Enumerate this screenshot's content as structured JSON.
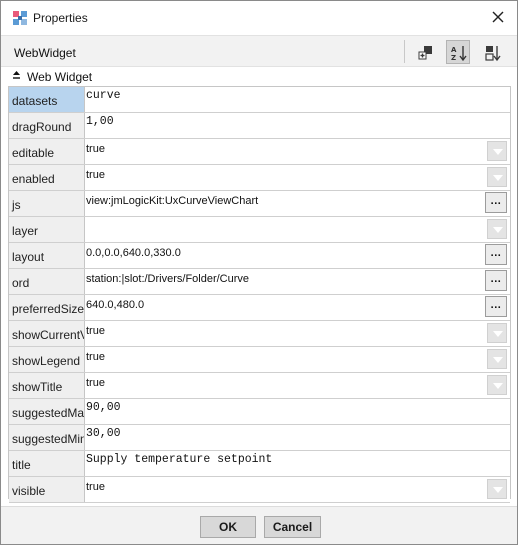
{
  "window": {
    "title": "Properties",
    "icon": "properties-app-icon",
    "close_icon": "close-icon"
  },
  "header": {
    "title": "WebWidget",
    "tools": [
      {
        "icon": "add-slot-icon",
        "active": false
      },
      {
        "icon": "sort-alphabetical-icon",
        "active": true
      },
      {
        "icon": "sort-order-icon",
        "active": false
      }
    ]
  },
  "breadcrumb": {
    "label": "Web Widget",
    "icon": "collapse-up-icon"
  },
  "properties": [
    {
      "name": "datasets",
      "value": "curve",
      "editor": "text",
      "mono": true,
      "selected": true
    },
    {
      "name": "dragRound",
      "value": "1,00",
      "editor": "text",
      "mono": true
    },
    {
      "name": "editable",
      "value": "true",
      "editor": "dropdown"
    },
    {
      "name": "enabled",
      "value": "true",
      "editor": "dropdown"
    },
    {
      "name": "js",
      "value": "view:jmLogicKit:UxCurveViewChart",
      "editor": "ellipsis",
      "button": "..."
    },
    {
      "name": "layer",
      "value": "",
      "editor": "dropdown"
    },
    {
      "name": "layout",
      "value": "0.0,0.0,640.0,330.0",
      "editor": "ellipsis",
      "button": "..."
    },
    {
      "name": "ord",
      "value": "station:|slot:/Drivers/Folder/Curve",
      "editor": "ellipsis",
      "button": "..."
    },
    {
      "name": "preferredSize",
      "value": "640.0,480.0",
      "editor": "ellipsis",
      "button": "..."
    },
    {
      "name": "showCurrentValue",
      "value": "true",
      "editor": "dropdown"
    },
    {
      "name": "showLegend",
      "value": "true",
      "editor": "dropdown"
    },
    {
      "name": "showTitle",
      "value": "true",
      "editor": "dropdown"
    },
    {
      "name": "suggestedMax",
      "value": "90,00",
      "editor": "text",
      "mono": true
    },
    {
      "name": "suggestedMin",
      "value": "30,00",
      "editor": "text",
      "mono": true
    },
    {
      "name": "title",
      "value": "Supply temperature setpoint",
      "editor": "text",
      "mono": true
    },
    {
      "name": "visible",
      "value": "true",
      "editor": "dropdown"
    }
  ],
  "footer": {
    "ok_label": "OK",
    "cancel_label": "Cancel"
  },
  "colors": {
    "selected_row": "#b8d4ee",
    "name_column": "#efefef",
    "footer_bg": "#f2f2f2"
  }
}
